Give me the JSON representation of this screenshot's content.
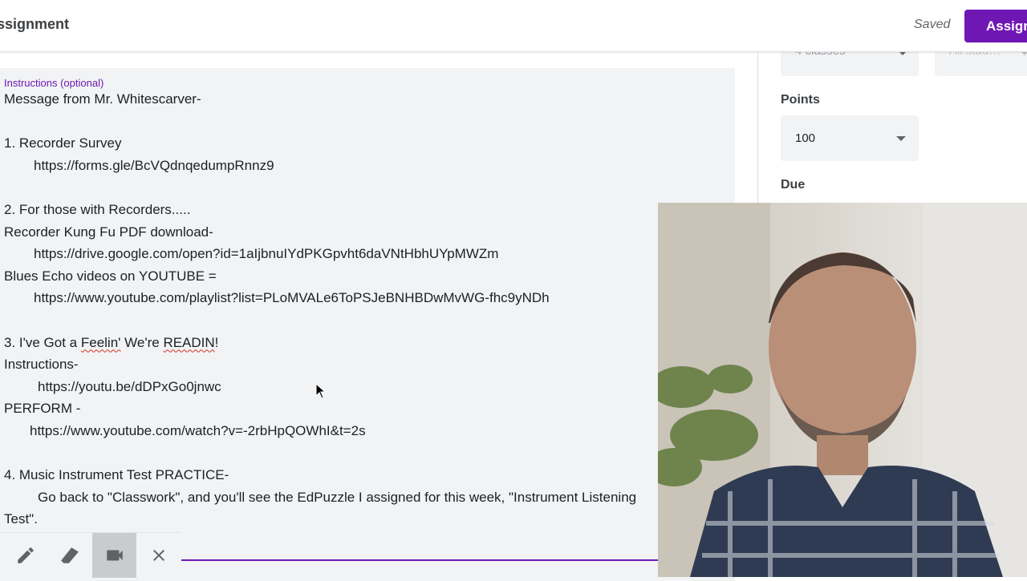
{
  "header": {
    "title": "ssignment",
    "saved_label": "Saved",
    "assign_label": "Assign",
    "accent_color": "#6f17b5"
  },
  "instructions": {
    "label": "Instructions (optional)",
    "lines": [
      "Message from Mr. Whitescarver-",
      "",
      "1. Recorder Survey",
      "https://forms.gle/BcVQdnqedumpRnnz9",
      "",
      "2. For those with Recorders.....",
      "Recorder Kung Fu PDF download-",
      "https://drive.google.com/open?id=1aIjbnuIYdPKGpvht6daVNtHbhUYpMWZm",
      "Blues Echo videos on YOUTUBE =",
      "https://www.youtube.com/playlist?list=PLoMVALe6ToPSJeBNHBDwMvWG-fhc9yNDh",
      "",
      "3. I've Got a Feelin' We're READIN!",
      "Instructions-",
      "https://youtu.be/dDPxGo0jnwc",
      "PERFORM -",
      "https://www.youtube.com/watch?v=-2rbHpQOWhI&t=2s",
      "",
      "4. Music Instrument Test PRACTICE-",
      "Go back to \"Classwork\", and you'll see the EdPuzzle I assigned for this week, \"Instrument Listening",
      "Test\"."
    ],
    "line3_prefix": "3. I've Got a ",
    "line3_word1": "Feelin'",
    "line3_mid": " We're ",
    "line3_word2": "READIN",
    "line3_suffix": "!"
  },
  "sidebar": {
    "for_value": "4 classes",
    "students_value": "All stud…",
    "points_label": "Points",
    "points_value": "100",
    "due_label": "Due"
  },
  "toolbar": {
    "tools": [
      "pencil-icon",
      "eraser-icon",
      "camera-icon",
      "close-icon"
    ]
  }
}
